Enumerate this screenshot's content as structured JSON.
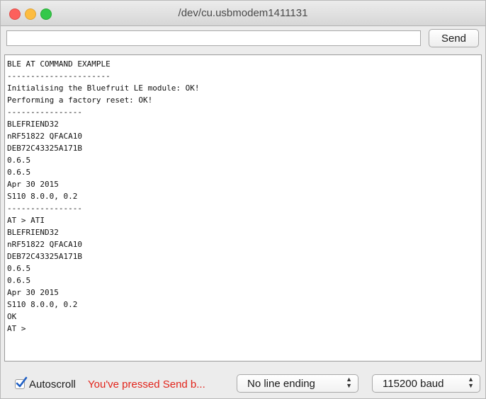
{
  "window": {
    "title": "/dev/cu.usbmodem1411131",
    "traffic_lights": {
      "close": "#fc605c",
      "minimize": "#fdbc40",
      "maximize": "#34c84a"
    }
  },
  "input": {
    "value": "",
    "placeholder": ""
  },
  "send_button": {
    "label": "Send"
  },
  "output": {
    "lines": [
      "BLE AT COMMAND EXAMPLE",
      "----------------------",
      "Initialising the Bluefruit LE module: OK!",
      "Performing a factory reset: OK!",
      "----------------",
      "BLEFRIEND32",
      "nRF51822 QFACA10",
      "DEB72C43325A171B",
      "0.6.5",
      "0.6.5",
      "Apr 30 2015",
      "S110 8.0.0, 0.2",
      "----------------",
      "AT > ATI",
      "BLEFRIEND32",
      "nRF51822 QFACA10",
      "DEB72C43325A171B",
      "0.6.5",
      "0.6.5",
      "Apr 30 2015",
      "S110 8.0.0, 0.2",
      "OK",
      "AT >"
    ]
  },
  "bottom": {
    "autoscroll_label": "Autoscroll",
    "autoscroll_checked": true,
    "status_message": "You've pressed Send b...",
    "status_color": "#e2231a",
    "line_ending": {
      "selected": "No line ending"
    },
    "baud": {
      "selected": "115200 baud"
    }
  },
  "icons": {
    "checkbox": "checkmark-icon",
    "select_arrows": "updown-arrows-icon"
  }
}
